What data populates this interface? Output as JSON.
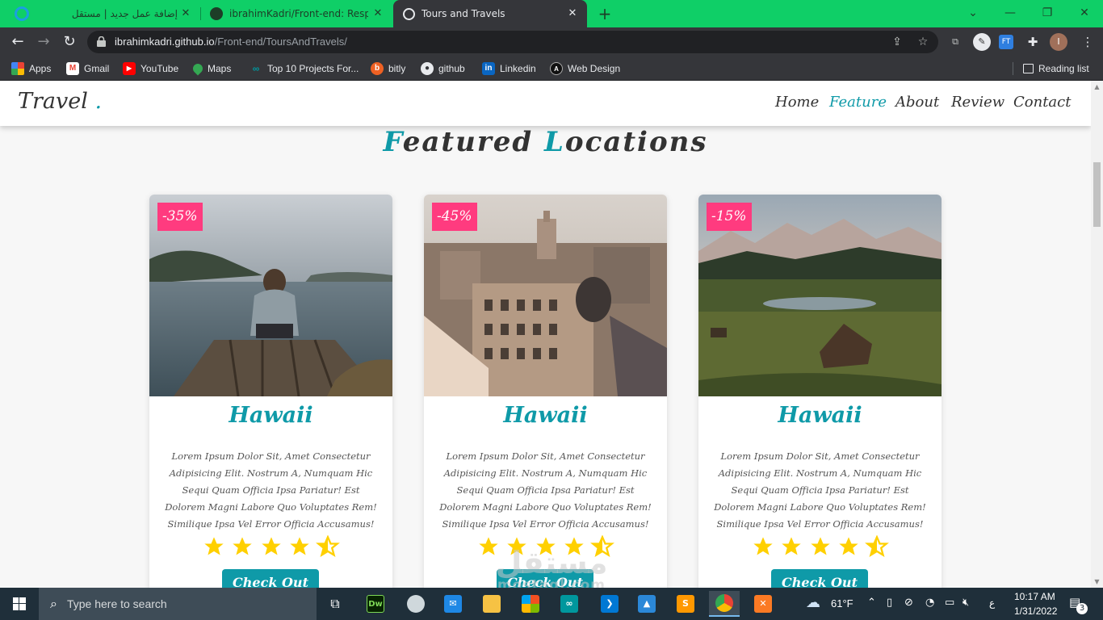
{
  "browser": {
    "tabs": [
      {
        "title": "إضافة عمل جديد | مستقل",
        "active": false,
        "icon": "mostaql-icon"
      },
      {
        "title": "ibrahimKadri/Front-end: Respons",
        "active": false,
        "icon": "github-icon"
      },
      {
        "title": "Tours and Travels",
        "active": true,
        "icon": "globe-icon"
      }
    ],
    "new_tab_label": "+",
    "url_host": "ibrahimkadri.github.io",
    "url_path": "/Front-end/ToursAndTravels/",
    "profile_initial": "I",
    "ext_ft_label": "FT"
  },
  "bookmarks": [
    {
      "label": "Apps",
      "icon": "apps-grid-icon"
    },
    {
      "label": "Gmail",
      "icon": "gmail-icon"
    },
    {
      "label": "YouTube",
      "icon": "youtube-icon"
    },
    {
      "label": "Maps",
      "icon": "maps-icon"
    },
    {
      "label": "Top 10 Projects For...",
      "icon": "arduino-icon"
    },
    {
      "label": "bitly",
      "icon": "bitly-icon"
    },
    {
      "label": "github",
      "icon": "github-icon"
    },
    {
      "label": "Linkedin",
      "icon": "linkedin-icon"
    },
    {
      "label": "Web Design",
      "icon": "webdesign-icon"
    }
  ],
  "reading_list_label": "Reading list",
  "site": {
    "logo_text": "Travel ",
    "logo_dot": ".",
    "nav": [
      {
        "label": "Home",
        "active": false
      },
      {
        "label": "Feature",
        "active": true
      },
      {
        "label": "About",
        "active": false
      },
      {
        "label": "Review",
        "active": false
      },
      {
        "label": "Contact",
        "active": false
      }
    ],
    "section_title": {
      "w1_initial": "F",
      "w1_rest": "eatured ",
      "w2_initial": "L",
      "w2_rest": "ocations"
    },
    "cards": [
      {
        "discount": "-35%",
        "title": "Hawaii",
        "rating": 4.5,
        "button": "Check Out",
        "text": "Lorem Ipsum Dolor Sit, Amet Consectetur Adipisicing Elit. Nostrum A, Numquam Hic Sequi Quam Officia Ipsa Pariatur! Est Dolorem Magni Labore Quo Voluptates Rem! Similique Ipsa Vel Error Officia Accusamus!"
      },
      {
        "discount": "-45%",
        "title": "Hawaii",
        "rating": 4.5,
        "button": "Check Out",
        "text": "Lorem Ipsum Dolor Sit, Amet Consectetur Adipisicing Elit. Nostrum A, Numquam Hic Sequi Quam Officia Ipsa Pariatur! Est Dolorem Magni Labore Quo Voluptates Rem! Similique Ipsa Vel Error Officia Accusamus!"
      },
      {
        "discount": "-15%",
        "title": "Hawaii",
        "rating": 4.5,
        "button": "Check Out",
        "text": "Lorem Ipsum Dolor Sit, Amet Consectetur Adipisicing Elit. Nostrum A, Numquam Hic Sequi Quam Officia Ipsa Pariatur! Est Dolorem Magni Labore Quo Voluptates Rem! Similique Ipsa Vel Error Officia Accusamus!"
      }
    ]
  },
  "watermark": {
    "top": "مستقل",
    "bottom": "mostaql.com"
  },
  "taskbar": {
    "search_placeholder": "Type here to search",
    "weather": "61°F",
    "time": "10:17 AM",
    "date": "1/31/2022",
    "lang": "ع",
    "notifications": "3"
  },
  "colors": {
    "accent": "#0f9aa8",
    "discount": "#ff3b7f",
    "star": "#ffd000",
    "tabbar": "#0fcf67"
  }
}
